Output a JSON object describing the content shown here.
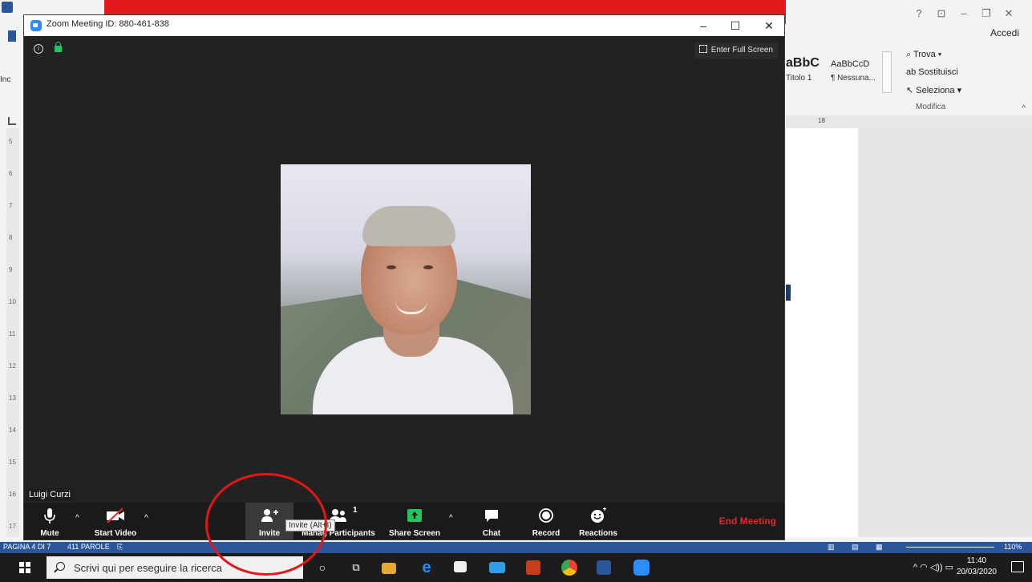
{
  "zoom": {
    "title": "Zoom Meeting ID: 880-461-838",
    "fullscreen_label": "Enter Full Screen",
    "participant_name": "Luigi Curzi",
    "toolbar": {
      "mute": "Mute",
      "start_video": "Start Video",
      "invite": "Invite",
      "manage_participants": "Manag  Participants",
      "participant_count": "1",
      "share_screen": "Share Screen",
      "chat": "Chat",
      "record": "Record",
      "reactions": "Reactions",
      "end_meeting": "End Meeting"
    },
    "tooltip": "Invite (Alt+I)"
  },
  "word": {
    "accedi": "Accedi",
    "style_1_preview": "aBbC",
    "style_1_name": "Titolo 1",
    "style_2_preview": "AaBbCcD",
    "style_2_name": "¶ Nessuna...",
    "find": "Trova",
    "replace": "Sostituisci",
    "select": "Seleziona",
    "group_label": "Modifica",
    "ruler_number": "18",
    "left_ribbon_text": "Inc",
    "status_page": "PAGINA 4 DI 7",
    "status_words": "411 PAROLE",
    "zoom_percent": "110%",
    "ruler_numbers": [
      "5",
      "6",
      "7",
      "8",
      "9",
      "10",
      "11",
      "12",
      "13",
      "14",
      "15",
      "16",
      "17"
    ]
  },
  "taskbar": {
    "search_placeholder": "Scrivi qui per eseguire la ricerca",
    "time": "11:40",
    "date": "20/03/2020"
  },
  "colors": {
    "zoom_dark": "#222222",
    "toolbar": "#1a1a1a",
    "end_meeting": "#e02828",
    "share_green": "#22c55e",
    "annotation_red": "#e41616",
    "word_blue": "#2b579a"
  }
}
